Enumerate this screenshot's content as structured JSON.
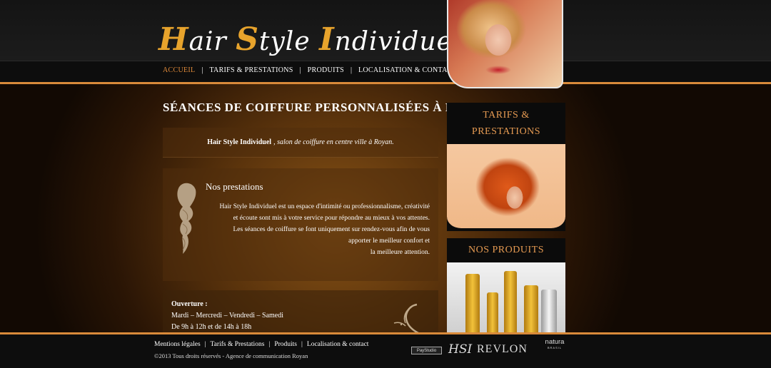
{
  "header": {
    "logo_text": "Hair Style Individuel",
    "logo_parts": [
      "H",
      "air ",
      "S",
      "tyle ",
      "I",
      "ndividuel"
    ]
  },
  "nav": {
    "items": [
      {
        "label": "ACCUEIL",
        "active": true
      },
      {
        "label": "TARIFS & PRESTATIONS",
        "active": false
      },
      {
        "label": "PRODUITS",
        "active": false
      },
      {
        "label": "LOCALISATION & CONTACT",
        "active": false
      }
    ],
    "separator": "|"
  },
  "main": {
    "title": "SÉANCES DE COIFFURE PERSONNALISÉES À ROYAN",
    "intro_bold": "Hair Style Individuel",
    "intro_italic": ", salon de coiffure en centre ville à Royan.",
    "services_title": "Nos prestations",
    "services_lines": [
      "Hair Style Individuel est un espace d'intimité ou professionnalisme, créativité",
      "et écoute sont mis à votre service pour répondre au mieux à vos attentes.",
      "Les séances de coiffure se font uniquement sur rendez-vous afin de vous",
      "apporter le meilleur confort et",
      "la meilleure attention."
    ],
    "hours_label": "Ouverture :",
    "hours_days": "Mardi – Mercredi – Vendredi – Samedi",
    "hours_times": "De 9h à 12h et de 14h à 18h"
  },
  "sidebar": {
    "card1_title": "TARIFS & PRESTATIONS",
    "card2_title": "NOS PRODUITS"
  },
  "footer": {
    "links": [
      "Mentions légales",
      "Tarifs & Prestations",
      "Produits",
      "Localisation & contact"
    ],
    "separator": "|",
    "copyright": "©2013 Tous droits réservés - Agence de communication Royan",
    "partners": {
      "small": "PayStudio",
      "hsi": "HSI",
      "revlon": "REVLON",
      "natura": "natura",
      "natura_sub": "BRASIL"
    }
  },
  "colors": {
    "accent": "#d98a3a",
    "logo_gold": "#e7a32c",
    "sidebar_title": "#e59a52",
    "nav_active": "#e08a3a"
  }
}
